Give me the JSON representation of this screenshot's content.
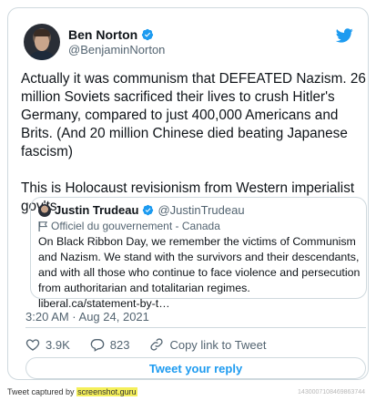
{
  "tweet": {
    "author_name": "Ben Norton",
    "author_handle": "@BenjaminNorton",
    "paragraph1": "Actually it was communism that DEFEATED Nazism. 26 million Soviets sacrificed their lives to crush Hitler's Germany, compared to just 400,000 Americans and Brits. (And 20 million Chinese died beating Japanese fascism)",
    "paragraph2": "This is Holocaust revisionism from Western imperialist gov'ts",
    "timestamp": "3:20 AM · Aug 24, 2021",
    "likes": "3.9K",
    "replies": "823",
    "copy_link_label": "Copy link to Tweet",
    "reply_button_label": "Tweet your reply"
  },
  "quoted": {
    "author_name": "Justin Trudeau",
    "author_handle": "@JustinTrudeau",
    "label": "Officiel du gouvernement - Canada",
    "text": "On Black Ribbon Day, we remember the victims of Communism and Nazism. We stand with the survivors and their descendants, and with all those who continue to face violence and persecution from authoritarian and totalitarian regimes.",
    "link": "liberal.ca/statement-by-t…"
  },
  "footer": {
    "prefix": "Tweet captured by",
    "site": "screenshot.guru",
    "tweet_id": "1430007108469863744"
  },
  "colors": {
    "accent": "#1d9bf0",
    "border": "#cfd9de",
    "secondary_text": "#536471",
    "highlight": "#f4ef5a"
  },
  "icons": [
    "verified-badge-icon",
    "twitter-bird-icon",
    "government-flag-icon",
    "heart-icon",
    "reply-bubble-icon",
    "link-icon"
  ]
}
